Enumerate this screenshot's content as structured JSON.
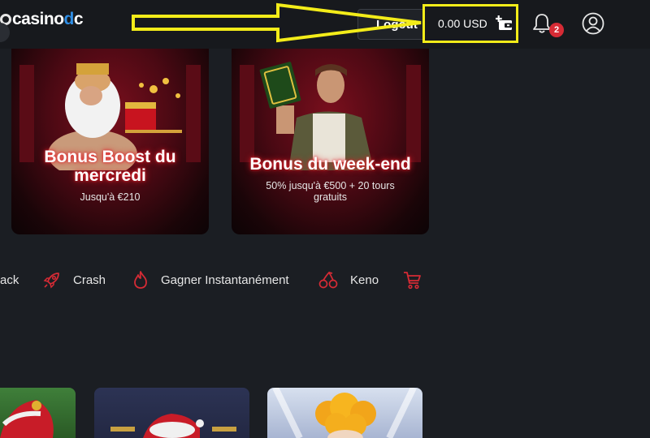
{
  "header": {
    "logo": {
      "prefix": "casino",
      "accent": "d",
      "suffix": "c"
    },
    "logout_label": "Logout",
    "balance": "0.00 USD",
    "notification_count": "2"
  },
  "promos": [
    {
      "title_line1": "Bonus Boost du",
      "title_line2": "mercredi",
      "subtitle": "Jusqu'à €210"
    },
    {
      "title": "Bonus du week-end",
      "subtitle": "50% jusqu'à €500 + 20 tours gratuits"
    }
  ],
  "categories": [
    {
      "label": "ack",
      "icon": "card-icon"
    },
    {
      "label": "Crash",
      "icon": "rocket-icon"
    },
    {
      "label": "Gagner Instantanément",
      "icon": "flame-icon"
    },
    {
      "label": "Keno",
      "icon": "cherries-icon"
    },
    {
      "label": "",
      "icon": "cart-icon"
    }
  ],
  "colors": {
    "background": "#1b1e23",
    "header": "#17191d",
    "accent": "#2f8ee5",
    "annotation": "#f3ec19",
    "icon_red": "#d62b35",
    "badge": "#d62b35"
  }
}
